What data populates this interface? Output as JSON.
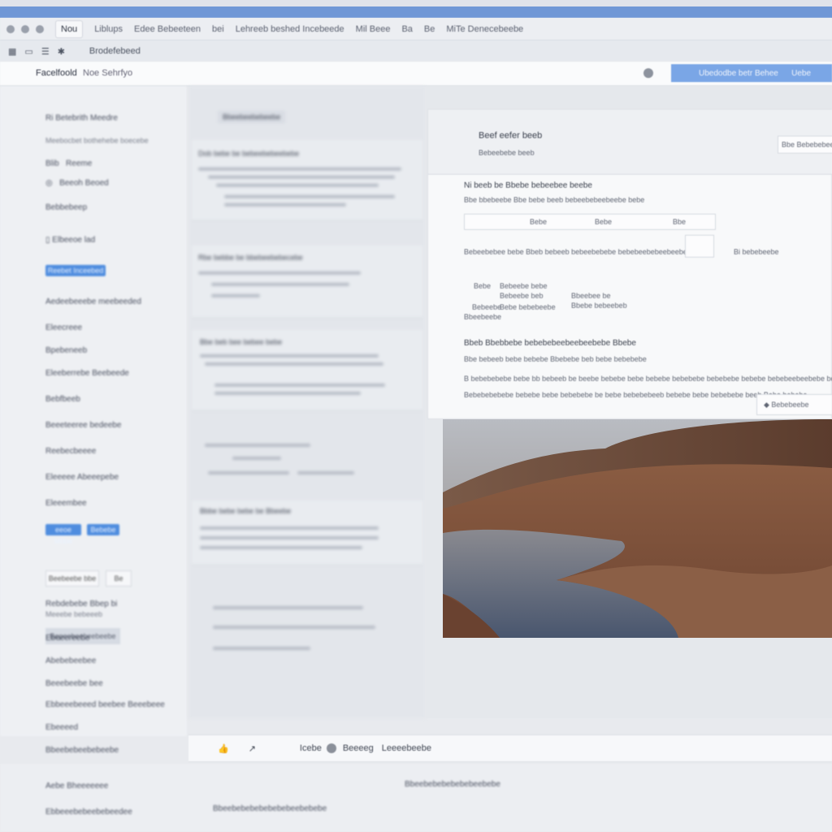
{
  "tabbar": {
    "tabs": [
      "Liblups",
      "Edee Bebeeteen",
      "bei",
      "Lehreeb beshed Incebeede",
      "Mil Beee",
      "Ba",
      "Be",
      "MiTe Denecebeebe"
    ],
    "active_tab": "Nou"
  },
  "toolbar": {
    "label": "Brodefebeed"
  },
  "address": {
    "site": "Facelfoold",
    "sub": "Noe Sehrfyo",
    "primary_button": "Ubedodbe betr Behee",
    "secondary": "Uebe"
  },
  "sidebar": {
    "heading": "Ri Betebrith Meedre",
    "sub": "Meebocbet bothehebe boecebe",
    "items": [
      {
        "label": "Reeme",
        "prefix": "Blib"
      },
      {
        "label": "Beeoh Beoed"
      },
      {
        "label": "Bebbebeep"
      },
      {
        "label": "Elbeeoe",
        "badge": "lad"
      },
      {
        "label": "Reebet Inceebed"
      },
      {
        "label": "Aedeebeeebe meebeeded"
      },
      {
        "label": "Eleecreee"
      },
      {
        "label": "Bpebeneeb"
      },
      {
        "label": "Eleeberrebe Beebeede"
      },
      {
        "label": "Bebfbeeb"
      },
      {
        "label": "Beeeteeree bedeebe"
      },
      {
        "label": "Reebecbeeee"
      },
      {
        "label": "Eleeeee Abeeepebe"
      },
      {
        "label": "Eleeembee"
      },
      {
        "btn1": "eeoe Mbbe",
        "btn2": "Bebebe"
      },
      {
        "label": "Bepeebeebeebeebe"
      },
      {
        "box1": "Beebeebe bbe",
        "box2": "Be"
      },
      {
        "label": "Rebdebebe Bbep bi",
        "label2": "Meeebe bebeeeb"
      },
      {
        "label": "Ebeeereebe"
      },
      {
        "label": "Abebebeebee"
      },
      {
        "label": "Beeebeebe bee"
      },
      {
        "label": "Ebbeeebeeed beebee Beeebeee"
      },
      {
        "label": "Ebeeeed"
      },
      {
        "label": "Bbeebebeebebeebe"
      },
      {
        "label": "Aebe Bheeeeeeee"
      },
      {
        "label": "Ebbeeebebeebebeedee"
      }
    ]
  },
  "middle": {
    "top_button": "Bbeebeebebeebe",
    "cards": [
      {
        "title": "Dob bebe be bebeebebeebebe"
      },
      {
        "title": "Rbe bebbe be bbebeebebecebe"
      },
      {
        "title": "Bbe beb bee bebee bebe"
      },
      {
        "title": "Bbbe bebe bebe be Bbeebe"
      }
    ]
  },
  "panel": {
    "title": "Beef eefer beeb",
    "meta": "Bebeebebe beeb",
    "search": "Bbe Bebebebee",
    "section1_title": "Ni beeb be Bbebe bebeebee beebe",
    "section1_sub": "Bbe bbebeebe Bbe bebe beeb bebeebebeebeebe bebe",
    "fields": [
      "Bebe",
      "Bebe",
      "Bbe"
    ],
    "row_text": "Bebeebebee bebe Bbeb bebeeb bebeebebebe bebebeebebeebeebebe",
    "count": "Bi bebebeebe",
    "labels_left": [
      "Bebe",
      "Bebeebe",
      "Bbeebeebe",
      "Bbeebee be"
    ],
    "labels_right": [
      "Bebeebe bebe",
      "Bebeebe beb",
      "Bebe bebebeebe",
      "Bbebe bebeebeb"
    ],
    "section2_title": "Bbeb Bbebbebe bebebebeebeebeebebe Bbebe",
    "section2_sub": "Bbe bebeeb bebe bebebe Bbebebe beb bebe bebebebe",
    "paragraph1": "B bebebebebe bebe bb bebeeb be beebe bebebe bebe bebebe bebebebe bebebebe bebebe bebebeebeebebe bebebe.",
    "paragraph2": "Bebebebebebe bebebe bebe bebebebe be bebe bebebebeeb bebebe bebe bebebebe beeb Bebe bebebe.",
    "footer_button": "Bebebeebe"
  },
  "bottombar": {
    "labels": [
      "Icebe",
      "Beeeeg",
      "Leeeebeebe"
    ]
  },
  "footer": {
    "left1": "Aebe Bheeeeeee",
    "left2": "Ebbeeebebeebebeedee",
    "center1": "Bbeebebebebebebeebebe",
    "center2": "Bbeebebebebebebebeebebebe"
  },
  "colors": {
    "accent": "#4f8ddf",
    "topbar": "#6f97d6",
    "primary_button": "#7aa6e6"
  }
}
